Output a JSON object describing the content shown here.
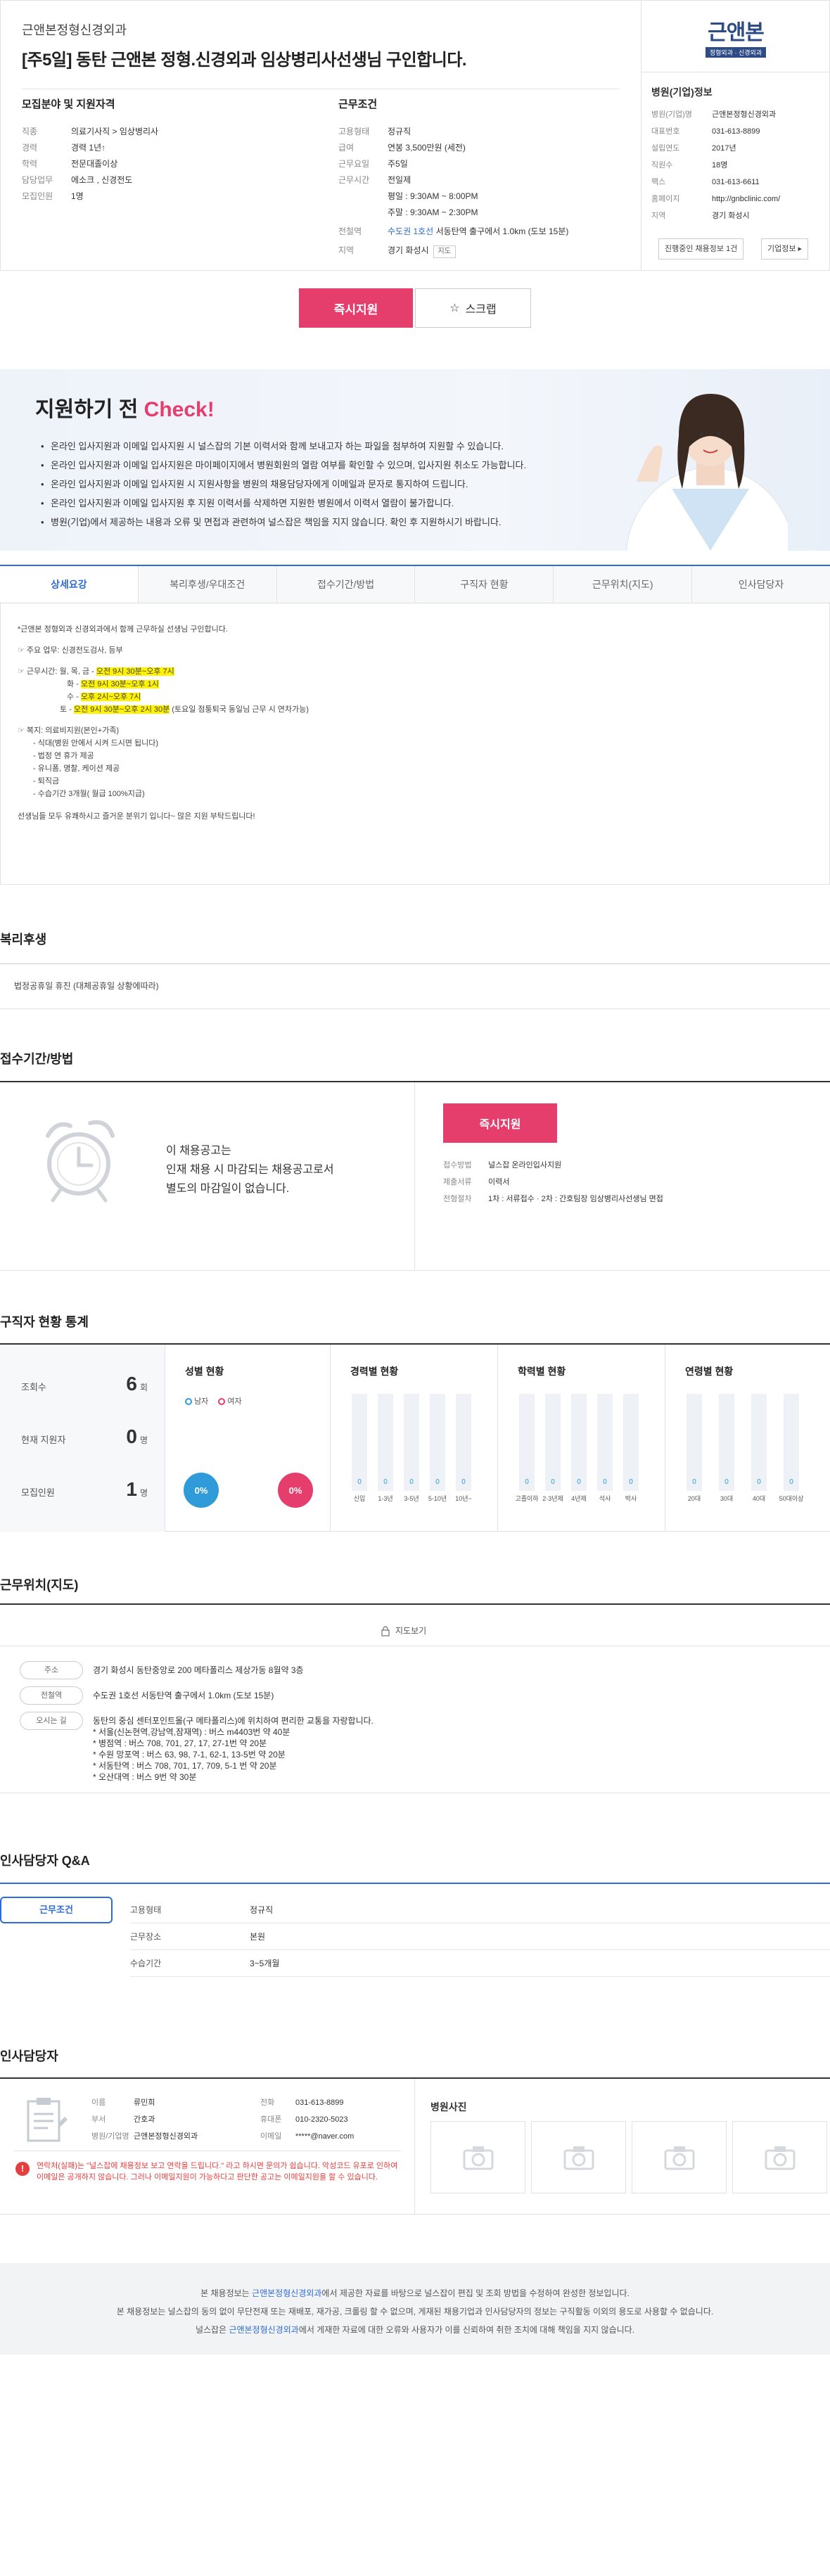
{
  "header": {
    "company_name": "근앤본정형신경외과",
    "job_title": "[주5일] 동탄 근앤본 정형.신경외과 임상병리사선생님 구인합니다."
  },
  "recruit": {
    "title": "모집분야 및 지원자격",
    "rows": [
      {
        "k": "직종",
        "v": "의료기사직 > 임상병리사"
      },
      {
        "k": "경력",
        "v": "경력 1년↑"
      },
      {
        "k": "학력",
        "v": "전문대졸이상"
      },
      {
        "k": "담당업무",
        "v": "에소크 , 신경전도"
      },
      {
        "k": "모집인원",
        "v": "1명"
      }
    ]
  },
  "conditions": {
    "title": "근무조건",
    "rows": [
      {
        "k": "고용형태",
        "v": "정규직"
      },
      {
        "k": "급여",
        "v": "연봉 3,500만원 (세전)"
      },
      {
        "k": "근무요일",
        "v": "주5일"
      },
      {
        "k": "근무시간",
        "v": "전일제"
      },
      {
        "k": "",
        "v": "평일 : 9:30AM ~ 8:00PM"
      },
      {
        "k": "",
        "v": "주말 : 9:30AM ~ 2:30PM"
      },
      {
        "k": "전철역",
        "v_pre": "수도권 1호선",
        "v": "서동탄역 출구에서 1.0km (도보 15분)"
      },
      {
        "k": "지역",
        "v": "경기 화성시",
        "btn": "지도"
      }
    ]
  },
  "corp": {
    "logo_main": "근앤본",
    "logo_sub": "정형외과 · 신경외과",
    "title": "병원(기업)정보",
    "rows": [
      {
        "k": "병원(기업)명",
        "v": "근앤본정형신경외과"
      },
      {
        "k": "대표번호",
        "v": "031-613-8899"
      },
      {
        "k": "설립연도",
        "v": "2017년"
      },
      {
        "k": "직원수",
        "v": "18명"
      },
      {
        "k": "팩스",
        "v": "031-613-6611"
      },
      {
        "k": "홈페이지",
        "v": "http://gnbclinic.com/"
      },
      {
        "k": "지역",
        "v": "경기 화성시"
      }
    ],
    "btn_jobs": "진행중인 채용정보 1건",
    "btn_info": "기업정보 ▸"
  },
  "actions": {
    "apply": "즉시지원",
    "scrap": "스크랩"
  },
  "check": {
    "title_pre": "지원하기 전 ",
    "title_accent": "Check!",
    "items": [
      "온라인 입사지원과 이메일 입사지원 시 널스잡의 기본 이력서와 함께 보내고자 하는 파일을 첨부하여 지원할 수 있습니다.",
      "온라인 입사지원과 이메일 입사지원은 마이페이지에서 병원회원의 열람 여부를 확인할 수 있으며, 입사지원 취소도 가능합니다.",
      "온라인 입사지원과 이메일 입사지원 시 지원사항을 병원의 채용담당자에게 이메일과 문자로 통지하여 드립니다.",
      "온라인 입사지원과 이메일 입사지원 후 지원 이력서를 삭제하면 지원한 병원에서 이력서 열람이 불가합니다.",
      "병원(기업)에서 제공하는 내용과 오류 및 면접과 관련하여 널스잡은 책임을 지지 않습니다. 확인 후 지원하시기 바랍니다."
    ]
  },
  "tabs": [
    "상세요강",
    "복리후생/우대조건",
    "접수기간/방법",
    "구직자 현황",
    "근무위치(지도)",
    "인사담당자"
  ],
  "detail": {
    "intro": "*근앤본 정형외과 신경외과에서 함께 근무하실 선생님 구인합니다.",
    "duty": "☞ 주요 업무: 신경전도검사, 등부",
    "hours_title": "☞ 근무시간: 월, 목, 금 -",
    "hours": [
      {
        "pre": "",
        "hl": "오전 9시 30분~오후 7시",
        "post": ""
      },
      {
        "pre": "화 - ",
        "hl": "오전 9시 30분~오후 1시",
        "post": ""
      },
      {
        "pre": "수 - ",
        "hl": "오후 2시~오후 7시",
        "post": ""
      },
      {
        "pre": "토 - ",
        "hl": "오전 9시 30분~오후 2시 30분",
        "post": " (토요일 점퉁퇴국 동일님 근무 시 연차가능)"
      }
    ],
    "benefit_title": "☞ 복지: 의료비지원(본인+가족)",
    "benefits": [
      "- 식대(병원 안에서 시켜 드시면 됩니다)",
      "- 법정 연 휴가 제공",
      "- 유니폼, 명찰, 케이션 제공",
      "- 퇴직금",
      "- 수습기간 3개월( 월급 100%지급)"
    ],
    "closing": "선생님들 모두 유쾌하시고 즐거운 분위기 입니다~ 많은 지원 부탁드립니다!"
  },
  "welfare": {
    "title": "복리후생",
    "text": "법정공휴일 휴진 (대체공휴일 상황에따라)"
  },
  "reception": {
    "title": "접수기간/방법",
    "msg_lines": [
      "이 채용공고는",
      "인재 채용 시 마감되는 채용공고로서",
      "별도의 마감일이 없습니다."
    ],
    "apply": "즉시지원",
    "rows": [
      {
        "k": "접수방법",
        "v": "널스잡 온라인입사지원"
      },
      {
        "k": "제출서류",
        "v": "이력서"
      },
      {
        "k": "전형절차",
        "v": "1차 : 서류접수 · 2차 : 간호팀장 임상병리사선생님 면접"
      }
    ]
  },
  "stats": {
    "title": "구직자 현황 통계",
    "views_label": "조회수",
    "views": "6",
    "views_unit": "회",
    "applicants_label": "현재 지원자",
    "applicants": "0",
    "applicants_unit": "명",
    "recruit_label": "모집인원",
    "recruit": "1",
    "recruit_unit": "명",
    "gender_title": "성별 현황",
    "male": "남자",
    "female": "여자",
    "male_pct": "0%",
    "female_pct": "0%",
    "career_title": "경력별 현황",
    "career_labels": [
      "신입",
      "1-3년",
      "3-5년",
      "5-10년",
      "10년~"
    ],
    "career_values": [
      "0",
      "0",
      "0",
      "0",
      "0"
    ],
    "edu_title": "학력별 현황",
    "edu_labels": [
      "고졸이하",
      "2·3년제",
      "4년제",
      "석사",
      "박사"
    ],
    "edu_values": [
      "0",
      "0",
      "0",
      "0",
      "0"
    ],
    "age_title": "연령별 현황",
    "age_labels": [
      "20대",
      "30대",
      "40대",
      "50대이상"
    ],
    "age_values": [
      "0",
      "0",
      "0",
      "0"
    ]
  },
  "location": {
    "title": "근무위치(지도)",
    "map_link": "지도보기",
    "address_label": "주소",
    "address": "경기 화성시 동탄중앙로 200 메타폴리스 제상가동 8월약 3층",
    "station_label": "전철역",
    "station": "수도권 1호선 서동탄역 출구에서 1.0km (도보 15분)",
    "route_label": "오시는 길",
    "route": [
      "동탄의 중심 센터포인트몰(구 메타폴리스)에 위치하여 편리한 교통을 자랑합니다.",
      "* 서울(신논현역,강남역,잠재역) : 버스 m4403번 약 40분",
      "* 병점역 : 버스 708, 701, 27, 17, 27-1번 약 20분",
      "* 수원 망포역 : 버스 63, 98, 7-1, 62-1, 13-5번 약 20분",
      "* 서동탄역 : 버스 708, 701, 17, 709, 5-1 번 약 20분",
      "* 오산대역 : 버스 9번 약 30분"
    ]
  },
  "qna": {
    "title": "인사담당자 Q&A",
    "tab": "근무조건",
    "rows": [
      {
        "k": "고용형태",
        "v": "정규직"
      },
      {
        "k": "근무장소",
        "v": "본원"
      },
      {
        "k": "수습기간",
        "v": "3~5개월"
      }
    ]
  },
  "hr": {
    "title": "인사담당자",
    "left_rows": [
      {
        "k": "이름",
        "v": "류민희"
      },
      {
        "k": "부서",
        "v": "간호과"
      },
      {
        "k": "병원/기업명",
        "v": "근앤본정형신경외과"
      }
    ],
    "right_rows": [
      {
        "k": "전화",
        "v": "031-613-8899"
      },
      {
        "k": "휴대폰",
        "v": "010-2320-5023"
      },
      {
        "k": "이메일",
        "v": "*****@naver.com"
      }
    ],
    "notice": "연락처(실패)는 \"널스잡에 채용정보 보고 연락을 드립니다.\" 라고 하시면 문의가 쉽습니다. 악성코드 유포로 인하여 이메일은 공개하지 않습니다. 그러나 이메일지원이 가능하다고 판단한 공고는 이메일지원을 할 수 있습니다.",
    "photo_title": "병원사진"
  },
  "footer": {
    "l1_pre": "본 채용정보는 ",
    "l1_name": "근앤본정형신경외과",
    "l1_post": "에서 제공한 자료를 바탕으로 널스잡이 편집 및 조회 방법을 수정하여 완성한 정보입니다.",
    "l2": "본 채용정보는 널스잡의 동의 없이 무단전재 또는 재배포, 재가공, 크롤링 할 수 없으며, 게재된 채용기업과 인사담당자의 정보는 구직활동 이외의 용도로 사용할 수 없습니다.",
    "l3_pre": "널스잡은 ",
    "l3_name": "근앤본정형신경외과",
    "l3_post": "에서 게재한 자료에 대한 오류와 사용자가 이를 신뢰하여 취한 조치에 대해 책임을 지지 않습니다."
  }
}
